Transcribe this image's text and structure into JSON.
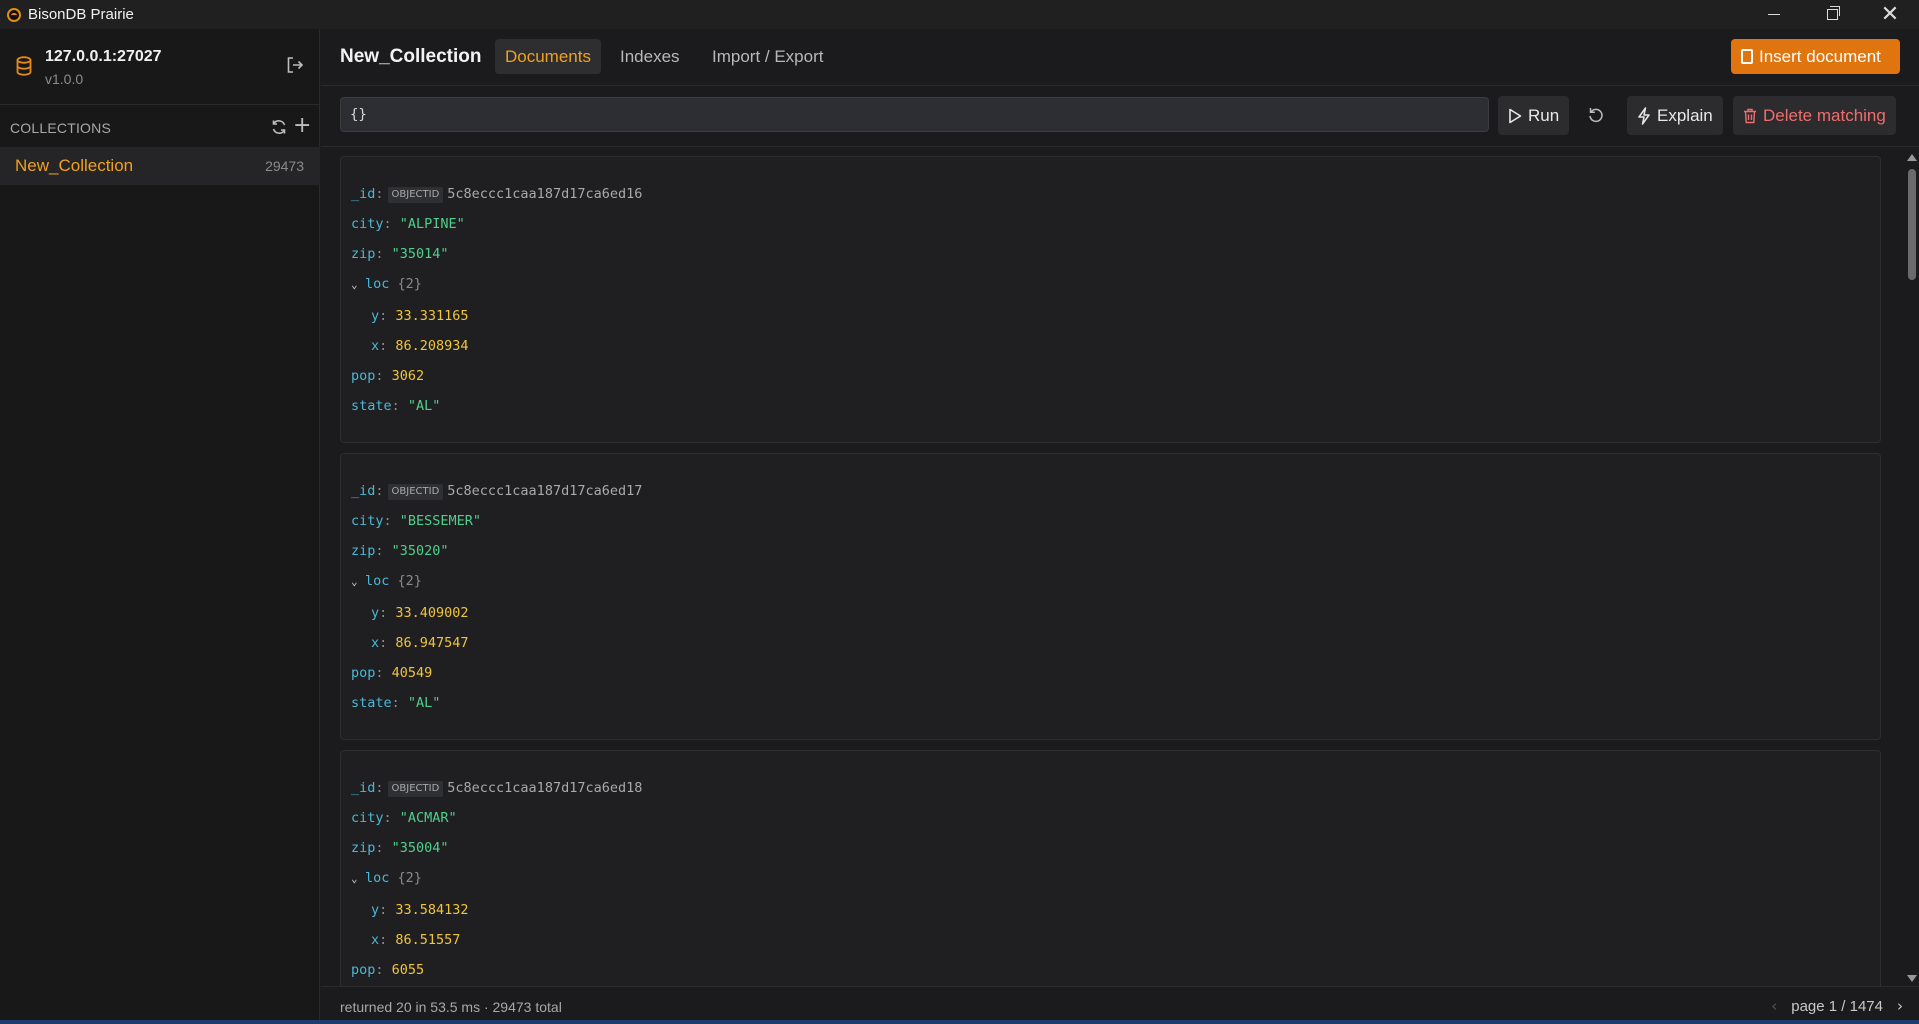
{
  "app": {
    "title": "BisonDB Prairie"
  },
  "connection": {
    "host": "127.0.0.1:27027",
    "version": "v1.0.0"
  },
  "sidebar": {
    "collections_title": "COLLECTIONS",
    "items": [
      {
        "name": "New_Collection",
        "count": "29473"
      }
    ]
  },
  "header": {
    "collection": "New_Collection",
    "tabs": [
      {
        "label": "Documents"
      },
      {
        "label": "Indexes"
      },
      {
        "label": "Import / Export"
      }
    ],
    "insert_label": "Insert document"
  },
  "query": {
    "value": "{}",
    "run_label": "Run",
    "explain_label": "Explain",
    "delete_label": "Delete matching"
  },
  "documents": [
    {
      "oid_tag": "OBJECTID",
      "id": "5c8eccc1caa187d17ca6ed16",
      "city": "\"ALPINE\"",
      "zip": "\"35014\"",
      "loc_count": "{2}",
      "y": "33.331165",
      "x": "86.208934",
      "pop": "3062",
      "state": "\"AL\""
    },
    {
      "oid_tag": "OBJECTID",
      "id": "5c8eccc1caa187d17ca6ed17",
      "city": "\"BESSEMER\"",
      "zip": "\"35020\"",
      "loc_count": "{2}",
      "y": "33.409002",
      "x": "86.947547",
      "pop": "40549",
      "state": "\"AL\""
    },
    {
      "oid_tag": "OBJECTID",
      "id": "5c8eccc1caa187d17ca6ed18",
      "city": "\"ACMAR\"",
      "zip": "\"35004\"",
      "loc_count": "{2}",
      "y": "33.584132",
      "x": "86.51557",
      "pop": "6055",
      "state": ""
    }
  ],
  "keys": {
    "id": "_id",
    "city": "city",
    "zip": "zip",
    "loc": "loc",
    "y": "y",
    "x": "x",
    "pop": "pop",
    "state": "state"
  },
  "status": {
    "text": "returned 20 in 53.5 ms · 29473 total",
    "page": "page 1 / 1474"
  },
  "colors": {
    "accent": "#f0a020",
    "primary_button": "#e0750f",
    "danger": "#ef6d6d",
    "key": "#49b8d6",
    "string": "#4fcf8b",
    "number": "#f0c43c"
  }
}
